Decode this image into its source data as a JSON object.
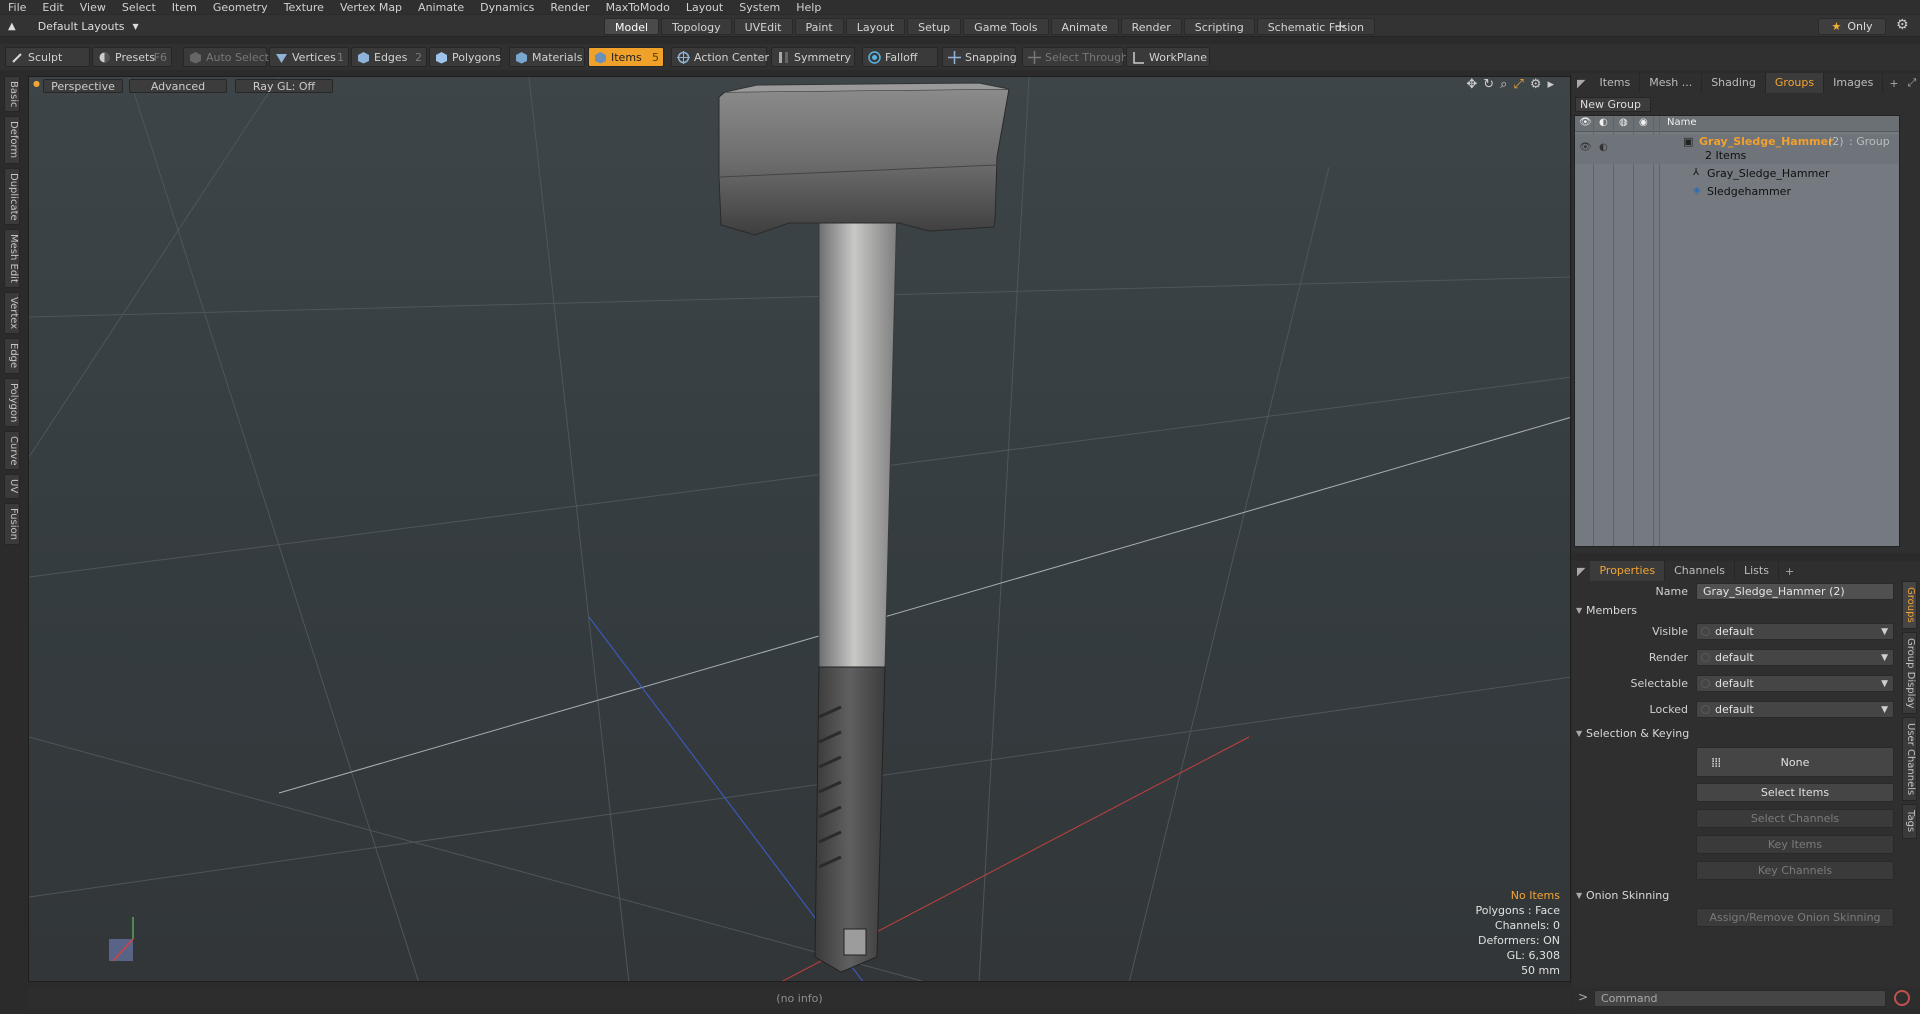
{
  "menu": [
    "File",
    "Edit",
    "View",
    "Select",
    "Item",
    "Geometry",
    "Texture",
    "Vertex Map",
    "Animate",
    "Dynamics",
    "Render",
    "MaxToModo",
    "Layout",
    "System",
    "Help"
  ],
  "layout_selector": "Default Layouts",
  "layout_tabs": [
    {
      "label": "Model",
      "active": true
    },
    {
      "label": "Topology",
      "active": false
    },
    {
      "label": "UVEdit",
      "active": false
    },
    {
      "label": "Paint",
      "active": false
    },
    {
      "label": "Layout",
      "active": false
    },
    {
      "label": "Setup",
      "active": false
    },
    {
      "label": "Game Tools",
      "active": false
    },
    {
      "label": "Animate",
      "active": false
    },
    {
      "label": "Render",
      "active": false
    },
    {
      "label": "Scripting",
      "active": false
    },
    {
      "label": "Schematic Fusion",
      "active": false
    }
  ],
  "only_label": "Only",
  "toolbar": {
    "sculpt": "Sculpt",
    "presets": "Presets",
    "presets_key": "F6",
    "auto_select": "Auto Select",
    "vertices": "Vertices",
    "vertices_key": "1",
    "edges": "Edges",
    "edges_key": "2",
    "polygons": "Polygons",
    "materials": "Materials",
    "items": "Items",
    "items_key": "5",
    "action_center": "Action Center",
    "symmetry": "Symmetry",
    "falloff": "Falloff",
    "snapping": "Snapping",
    "select_through": "Select Through",
    "workplane": "WorkPlane"
  },
  "left_tabs": [
    "Basic",
    "Deform",
    "Duplicate",
    "Mesh Edit",
    "Vertex",
    "Edge",
    "Polygon",
    "Curve",
    "UV",
    "Fusion"
  ],
  "viewport": {
    "view": "Perspective",
    "shading": "Advanced",
    "raygl": "Ray GL: Off",
    "info": {
      "no_items": "No Items",
      "polygons": "Polygons : Face",
      "channels": "Channels: 0",
      "deformers": "Deformers: ON",
      "gl": "GL: 6,308",
      "focal": "50 mm"
    }
  },
  "status": "(no info)",
  "right_top": {
    "tabs": [
      {
        "label": "Items",
        "active": false
      },
      {
        "label": "Mesh ...",
        "active": false
      },
      {
        "label": "Shading",
        "active": false
      },
      {
        "label": "Groups",
        "active": true
      },
      {
        "label": "Images",
        "active": false
      }
    ],
    "new_group": "New Group",
    "column_name": "Name",
    "group": {
      "name": "Gray_Sledge_Hammer",
      "count": "(2)",
      "type": ": Group",
      "items_count": "2 Items"
    },
    "children": [
      "Gray_Sledge_Hammer",
      "Sledgehammer"
    ]
  },
  "properties": {
    "tabs": [
      {
        "label": "Properties",
        "active": true
      },
      {
        "label": "Channels",
        "active": false
      },
      {
        "label": "Lists",
        "active": false
      }
    ],
    "name_label": "Name",
    "name_value": "Gray_Sledge_Hammer (2)",
    "members_section": "Members",
    "fields": [
      {
        "label": "Visible",
        "value": "default"
      },
      {
        "label": "Render",
        "value": "default"
      },
      {
        "label": "Selectable",
        "value": "default"
      },
      {
        "label": "Locked",
        "value": "default"
      }
    ],
    "selection_section": "Selection & Keying",
    "none_label": "None",
    "select_items": "Select Items",
    "select_channels": "Select Channels",
    "key_items": "Key Items",
    "key_channels": "Key Channels",
    "onion_section": "Onion Skinning",
    "onion_button": "Assign/Remove Onion Skinning",
    "side_tabs": [
      "Groups",
      "Group Display",
      "User Channels",
      "Tags"
    ]
  },
  "command_placeholder": "Command",
  "colors": {
    "accent": "#f3a534",
    "tree_bg": "#747a80",
    "viewport_bg": "#3a4246"
  }
}
